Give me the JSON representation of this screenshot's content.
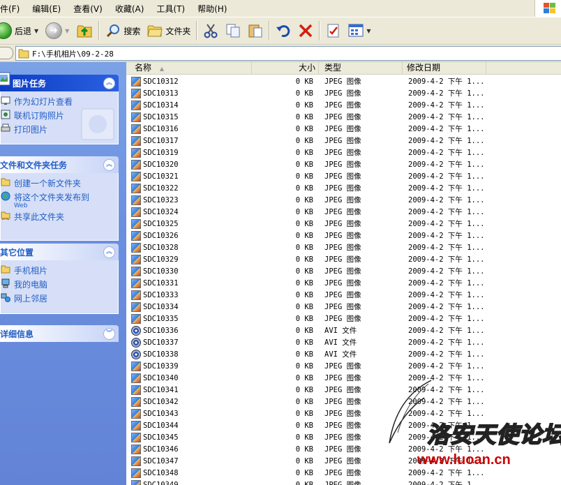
{
  "menu": [
    "件(F)",
    "编辑(E)",
    "查看(V)",
    "收藏(A)",
    "工具(T)",
    "帮助(H)"
  ],
  "toolbar": {
    "back_label": "后退",
    "search_label": "搜索",
    "folders_label": "文件夹"
  },
  "address": {
    "path": "F:\\手机相片\\09-2-28"
  },
  "panels": {
    "picture_tasks": {
      "title": "图片任务",
      "items": [
        "作为幻灯片查看",
        "联机订购照片",
        "打印图片"
      ]
    },
    "file_tasks": {
      "title": "文件和文件夹任务",
      "items": [
        "创建一个新文件夹",
        "将这个文件夹发布到",
        "共享此文件夹"
      ],
      "publish_sub": "Web"
    },
    "other_places": {
      "title": "其它位置",
      "items": [
        "手机相片",
        "我的电脑",
        "网上邻居"
      ]
    },
    "details": {
      "title": "详细信息"
    }
  },
  "columns": {
    "name": "名称",
    "size": "大小",
    "type": "类型",
    "date": "修改日期"
  },
  "files": [
    {
      "name": "SDC10312",
      "size": "0 KB",
      "type": "JPEG 图像",
      "date": "2009-4-2 下午 1...",
      "kind": "img"
    },
    {
      "name": "SDC10313",
      "size": "0 KB",
      "type": "JPEG 图像",
      "date": "2009-4-2 下午 1...",
      "kind": "img"
    },
    {
      "name": "SDC10314",
      "size": "0 KB",
      "type": "JPEG 图像",
      "date": "2009-4-2 下午 1...",
      "kind": "img"
    },
    {
      "name": "SDC10315",
      "size": "0 KB",
      "type": "JPEG 图像",
      "date": "2009-4-2 下午 1...",
      "kind": "img"
    },
    {
      "name": "SDC10316",
      "size": "0 KB",
      "type": "JPEG 图像",
      "date": "2009-4-2 下午 1...",
      "kind": "img"
    },
    {
      "name": "SDC10317",
      "size": "0 KB",
      "type": "JPEG 图像",
      "date": "2009-4-2 下午 1...",
      "kind": "img"
    },
    {
      "name": "SDC10319",
      "size": "0 KB",
      "type": "JPEG 图像",
      "date": "2009-4-2 下午 1...",
      "kind": "img"
    },
    {
      "name": "SDC10320",
      "size": "0 KB",
      "type": "JPEG 图像",
      "date": "2009-4-2 下午 1...",
      "kind": "img"
    },
    {
      "name": "SDC10321",
      "size": "0 KB",
      "type": "JPEG 图像",
      "date": "2009-4-2 下午 1...",
      "kind": "img"
    },
    {
      "name": "SDC10322",
      "size": "0 KB",
      "type": "JPEG 图像",
      "date": "2009-4-2 下午 1...",
      "kind": "img"
    },
    {
      "name": "SDC10323",
      "size": "0 KB",
      "type": "JPEG 图像",
      "date": "2009-4-2 下午 1...",
      "kind": "img"
    },
    {
      "name": "SDC10324",
      "size": "0 KB",
      "type": "JPEG 图像",
      "date": "2009-4-2 下午 1...",
      "kind": "img"
    },
    {
      "name": "SDC10325",
      "size": "0 KB",
      "type": "JPEG 图像",
      "date": "2009-4-2 下午 1...",
      "kind": "img"
    },
    {
      "name": "SDC10326",
      "size": "0 KB",
      "type": "JPEG 图像",
      "date": "2009-4-2 下午 1...",
      "kind": "img"
    },
    {
      "name": "SDC10328",
      "size": "0 KB",
      "type": "JPEG 图像",
      "date": "2009-4-2 下午 1...",
      "kind": "img"
    },
    {
      "name": "SDC10329",
      "size": "0 KB",
      "type": "JPEG 图像",
      "date": "2009-4-2 下午 1...",
      "kind": "img"
    },
    {
      "name": "SDC10330",
      "size": "0 KB",
      "type": "JPEG 图像",
      "date": "2009-4-2 下午 1...",
      "kind": "img"
    },
    {
      "name": "SDC10331",
      "size": "0 KB",
      "type": "JPEG 图像",
      "date": "2009-4-2 下午 1...",
      "kind": "img"
    },
    {
      "name": "SDC10333",
      "size": "0 KB",
      "type": "JPEG 图像",
      "date": "2009-4-2 下午 1...",
      "kind": "img"
    },
    {
      "name": "SDC10334",
      "size": "0 KB",
      "type": "JPEG 图像",
      "date": "2009-4-2 下午 1...",
      "kind": "img"
    },
    {
      "name": "SDC10335",
      "size": "0 KB",
      "type": "JPEG 图像",
      "date": "2009-4-2 下午 1...",
      "kind": "img"
    },
    {
      "name": "SDC10336",
      "size": "0 KB",
      "type": "AVI 文件",
      "date": "2009-4-2 下午 1...",
      "kind": "avi"
    },
    {
      "name": "SDC10337",
      "size": "0 KB",
      "type": "AVI 文件",
      "date": "2009-4-2 下午 1...",
      "kind": "avi"
    },
    {
      "name": "SDC10338",
      "size": "0 KB",
      "type": "AVI 文件",
      "date": "2009-4-2 下午 1...",
      "kind": "avi"
    },
    {
      "name": "SDC10339",
      "size": "0 KB",
      "type": "JPEG 图像",
      "date": "2009-4-2 下午 1...",
      "kind": "img"
    },
    {
      "name": "SDC10340",
      "size": "0 KB",
      "type": "JPEG 图像",
      "date": "2009-4-2 下午 1...",
      "kind": "img"
    },
    {
      "name": "SDC10341",
      "size": "0 KB",
      "type": "JPEG 图像",
      "date": "2009-4-2 下午 1...",
      "kind": "img"
    },
    {
      "name": "SDC10342",
      "size": "0 KB",
      "type": "JPEG 图像",
      "date": "2009-4-2 下午 1...",
      "kind": "img"
    },
    {
      "name": "SDC10343",
      "size": "0 KB",
      "type": "JPEG 图像",
      "date": "2009-4-2 下午 1...",
      "kind": "img"
    },
    {
      "name": "SDC10344",
      "size": "0 KB",
      "type": "JPEG 图像",
      "date": "2009-4-2 下午 1...",
      "kind": "img"
    },
    {
      "name": "SDC10345",
      "size": "0 KB",
      "type": "JPEG 图像",
      "date": "2009-4-2 下午 1...",
      "kind": "img"
    },
    {
      "name": "SDC10346",
      "size": "0 KB",
      "type": "JPEG 图像",
      "date": "2009-4-2 下午 1...",
      "kind": "img"
    },
    {
      "name": "SDC10347",
      "size": "0 KB",
      "type": "JPEG 图像",
      "date": "2009-4-2 下午 1...",
      "kind": "img"
    },
    {
      "name": "SDC10348",
      "size": "0 KB",
      "type": "JPEG 图像",
      "date": "2009-4-2 下午 1...",
      "kind": "img"
    },
    {
      "name": "SDC10349",
      "size": "0 KB",
      "type": "JPEG 图像",
      "date": "2009-4-2 下午 1...",
      "kind": "img"
    }
  ],
  "watermark": {
    "text": "洛安天使论坛",
    "url": "www.luoan.cn"
  }
}
